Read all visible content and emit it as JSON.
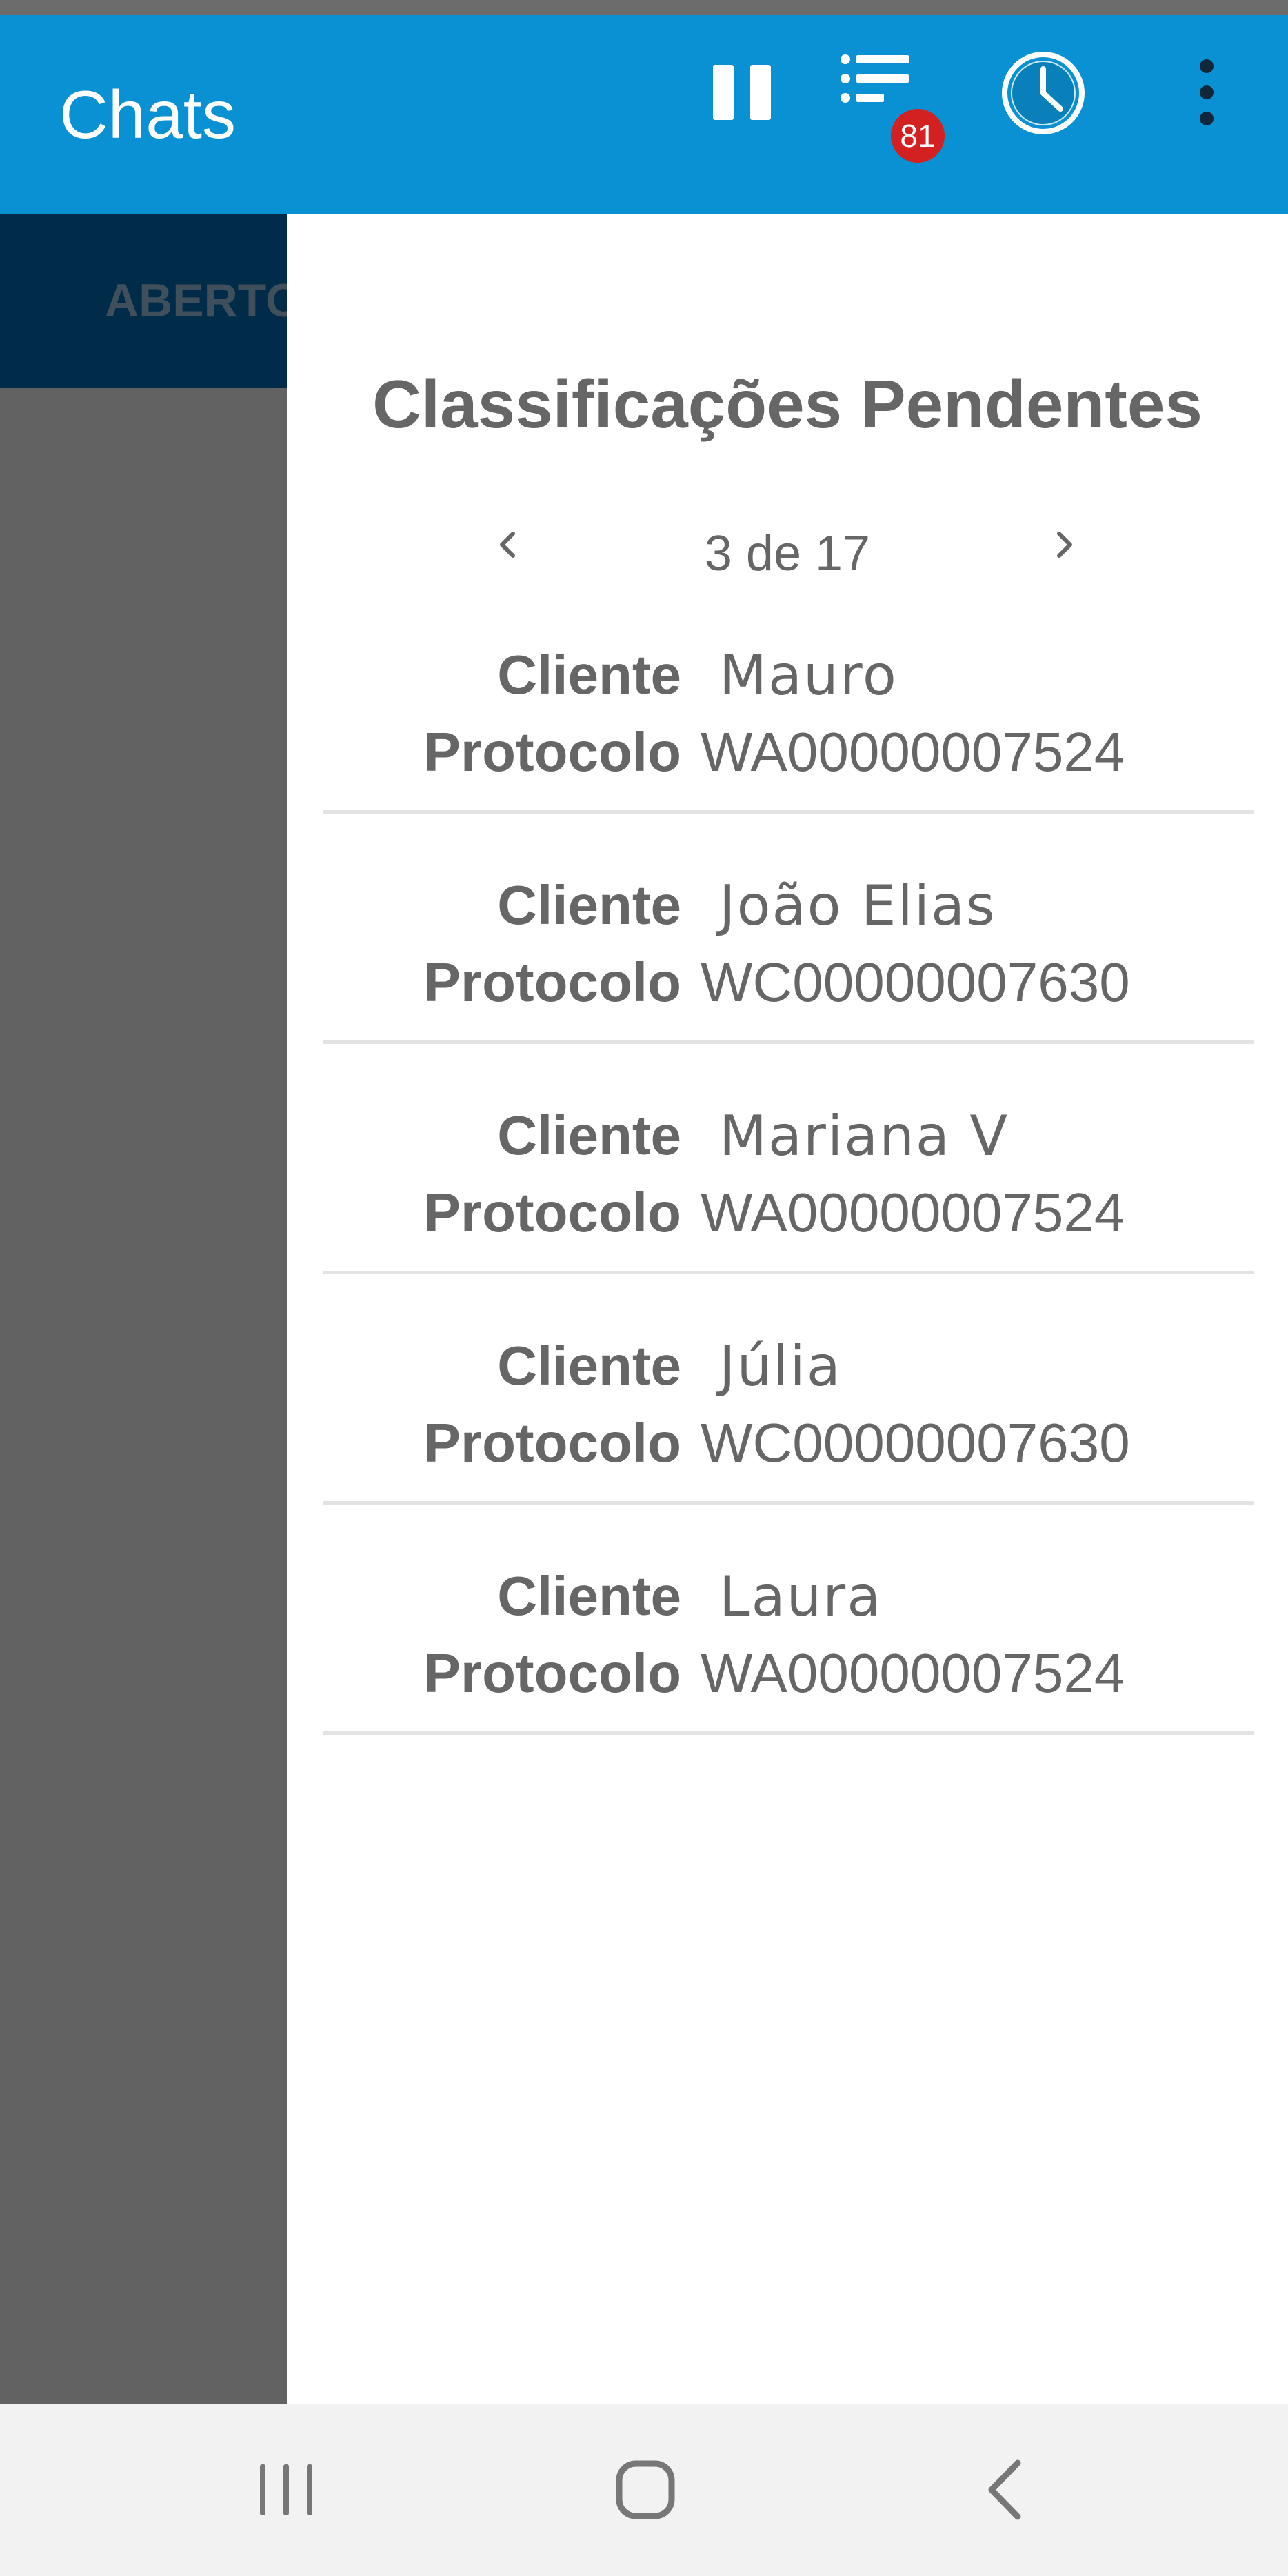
{
  "app_bar": {
    "title": "Chats",
    "badge_count": "81",
    "icons": [
      "pause-icon",
      "list-icon",
      "clock-icon",
      "more-vert-icon"
    ],
    "color": "#0a91d3"
  },
  "tabs": {
    "visible_label": "ABERTO"
  },
  "drawer": {
    "title": "Classificações Pendentes",
    "pager": {
      "text": "3 de 17",
      "prev_icon": "chevron-left-icon",
      "next_icon": "chevron-right-icon"
    },
    "client_label": "Cliente",
    "protocol_label": "Protocolo",
    "items": [
      {
        "cliente": "Mauro",
        "protocolo": "WA00000007524"
      },
      {
        "cliente": "João Elias",
        "protocolo": "WC00000007630"
      },
      {
        "cliente": "Mariana V",
        "protocolo": "WA00000007524"
      },
      {
        "cliente": "Júlia",
        "protocolo": "WC00000007630"
      },
      {
        "cliente": "Laura",
        "protocolo": "WA00000007524"
      }
    ]
  },
  "nav_bar": {
    "icons": [
      "recent-apps-icon",
      "home-icon",
      "back-icon"
    ]
  }
}
